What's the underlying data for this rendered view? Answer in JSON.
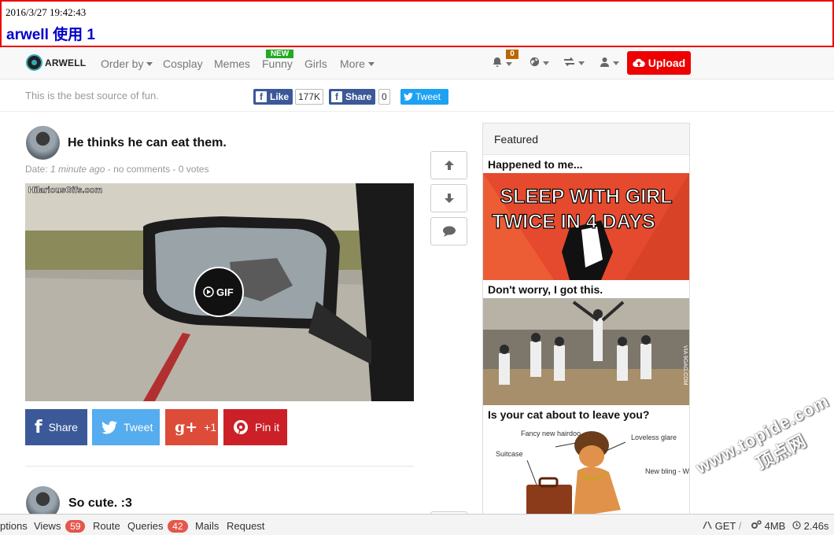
{
  "banner": {
    "timestamp": "2016/3/27 19:42:43",
    "title": "arwell 使用 1"
  },
  "nav": {
    "logo_text": "ARWELL",
    "links": [
      {
        "label": "Order by",
        "dropdown": true
      },
      {
        "label": "Cosplay"
      },
      {
        "label": "Memes"
      },
      {
        "label": "Funny",
        "badge": "NEW"
      },
      {
        "label": "Girls"
      },
      {
        "label": "More",
        "dropdown": true
      }
    ],
    "notification_count": "0",
    "upload_label": "Upload",
    "icons": [
      "bell-icon",
      "globe-icon",
      "exchange-icon",
      "user-icon",
      "cloud-upload-icon"
    ]
  },
  "subbar": {
    "tagline": "This is the best source of fun.",
    "like_label": "Like",
    "like_count": "177K",
    "fb_share_label": "Share",
    "fb_share_count": "0",
    "tweet_label": "Tweet"
  },
  "post": {
    "title": "He thinks he can eat them.",
    "meta_prefix": "Date: ",
    "meta_time": "1 minute ago",
    "meta_rest": " - no comments - 0 votes",
    "image_watermark": "HilariousGifs.com",
    "gif_label": "GIF",
    "share_buttons": [
      {
        "label": "Share",
        "color": "#3b5998"
      },
      {
        "label": "Tweet",
        "color": "#55acee"
      },
      {
        "label": "+1",
        "color": "#dd4b39"
      },
      {
        "label": "Pin it",
        "color": "#cb2027"
      }
    ]
  },
  "post2": {
    "title": "So cute. :3"
  },
  "featured": {
    "header": "Featured",
    "items": [
      {
        "title": "Happened to me...",
        "meme_text_1": "SLEEP WITH GIRL",
        "meme_text_2": "TWICE IN 4 DAYS"
      },
      {
        "title": "Don't worry, I got this.",
        "image_side_text": "VIA 9GAG.COM"
      },
      {
        "title": "Is your cat about to leave you?",
        "labels": [
          "Fancy new hairdoo",
          "Loveless glare",
          "Suitcase",
          "New bling - Who gave her that?"
        ]
      }
    ]
  },
  "debug": {
    "options": "ptions",
    "views_label": "Views",
    "views_count": "59",
    "route": "Route",
    "queries_label": "Queries",
    "queries_count": "42",
    "mails": "Mails",
    "request": "Request",
    "method": "GET",
    "slash": "/",
    "memory": "4MB",
    "time": "2.46s"
  },
  "watermark": {
    "site": "www.topide.com",
    "cn": "顶点网"
  },
  "colors": {
    "upload": "#ee0000",
    "banner_border": "#ee0000",
    "banner_title": "#0000cc",
    "new_badge": "#22aa22",
    "facebook": "#3b5998",
    "twitter": "#1da1f2"
  }
}
